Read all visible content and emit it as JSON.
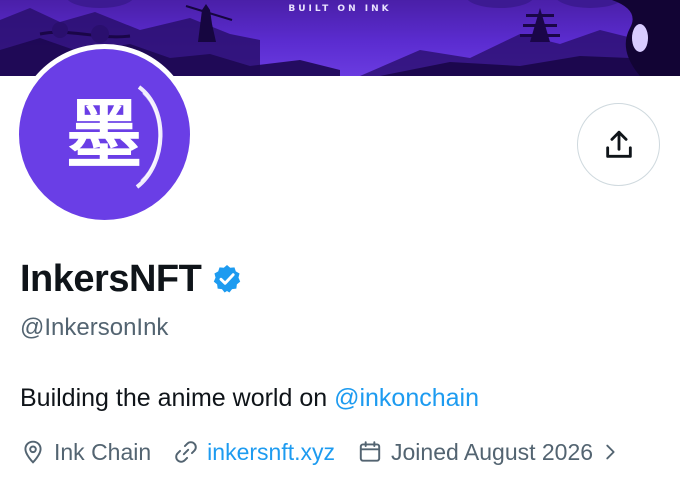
{
  "banner": {
    "caption": "BUILT ON INK",
    "bg_color": "#5b2cd0"
  },
  "avatar": {
    "glyph": "墨",
    "bg_color": "#6a3ee6"
  },
  "actions": {
    "share_icon": "share-upload-icon"
  },
  "profile": {
    "display_name": "InkersNFT",
    "verified_icon": "verified-badge-icon",
    "handle": "@InkersonInk",
    "bio_text": "Building the anime world on ",
    "bio_mention": "@inkonchain"
  },
  "meta": {
    "location": "Ink Chain",
    "location_icon": "location-pin-icon",
    "website": "inkersnft.xyz",
    "website_icon": "link-icon",
    "joined": "Joined August 2026",
    "joined_icon": "calendar-icon",
    "more_icon": "chevron-right-icon"
  },
  "colors": {
    "accent": "#1d9bf0",
    "secondary_text": "#536471",
    "primary_text": "#0f1419",
    "border": "#cfd9de"
  }
}
